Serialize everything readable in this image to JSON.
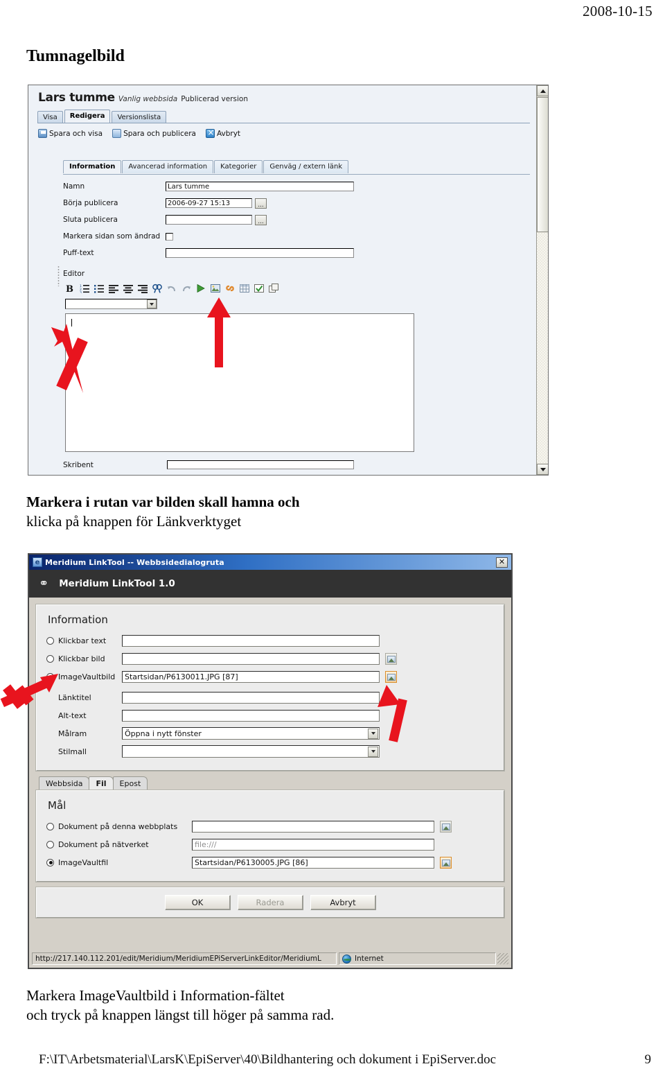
{
  "document": {
    "date": "2008-10-15",
    "title": "Tumnagelbild",
    "footer_path": "F:\\IT\\Arbetsmaterial\\LarsK\\EpiServer\\40\\Bildhantering och dokument i EpiServer.doc",
    "footer_page": "9"
  },
  "caption1": {
    "line1": "Markera i rutan var bilden skall hamna och",
    "line2": "klicka på knappen för Länkverktyget"
  },
  "caption2": {
    "line1": "Markera ImageVaultbild i Information-fältet",
    "line2": "och tryck på knappen längst till höger på samma rad."
  },
  "episerver": {
    "page_name": "Lars tumme",
    "page_type": "Vanlig webbsida",
    "page_status": "Publicerad version",
    "tabs": [
      {
        "label": "Visa",
        "active": false
      },
      {
        "label": "Redigera",
        "active": true
      },
      {
        "label": "Versionslista",
        "active": false
      }
    ],
    "commands": [
      {
        "label": "Spara och visa",
        "icon": "save-view-icon"
      },
      {
        "label": "Spara och publicera",
        "icon": "save-publish-icon"
      },
      {
        "label": "Avbryt",
        "icon": "cancel-icon"
      }
    ],
    "subtabs": [
      {
        "label": "Information",
        "active": true
      },
      {
        "label": "Avancerad information",
        "active": false
      },
      {
        "label": "Kategorier",
        "active": false
      },
      {
        "label": "Genväg / extern länk",
        "active": false
      }
    ],
    "fields": {
      "namn_label": "Namn",
      "namn_value": "Lars tumme",
      "borja_label": "Börja publicera",
      "borja_value": "2006-09-27 15:13",
      "sluta_label": "Sluta publicera",
      "sluta_value": "",
      "markera_label": "Markera sidan som ändrad",
      "puff_label": "Puff-text",
      "puff_value": "",
      "editor_label": "Editor",
      "skribent_label": "Skribent",
      "skribent_value": "",
      "browse_button": "...",
      "format_select_value": ""
    },
    "toolbar_icons": [
      "bold-icon",
      "ordered-list-icon",
      "unordered-list-icon",
      "align-left-icon",
      "align-center-icon",
      "align-right-icon",
      "find-icon",
      "undo-icon",
      "redo-icon",
      "spellcheck-icon",
      "insert-image-icon",
      "insert-link-icon",
      "insert-table-icon",
      "form-field-icon",
      "window-icon"
    ]
  },
  "linktool": {
    "window_title": "Meridium LinkTool -- Webbsidedialogruta",
    "close_label": "✕",
    "banner_icon": "link-chain-icon",
    "banner_title": "Meridium LinkTool 1.0",
    "information": {
      "heading": "Information",
      "rows": [
        {
          "label": "Klickbar text",
          "value": "",
          "radio": false,
          "has_radio": true,
          "has_button": false
        },
        {
          "label": "Klickbar bild",
          "value": "",
          "radio": false,
          "has_radio": true,
          "has_button": true
        },
        {
          "label": "ImageVaultbild",
          "value": "Startsidan/P6130011.JPG [87]",
          "radio": true,
          "has_radio": true,
          "has_button": true
        },
        {
          "label": "Länktitel",
          "value": "",
          "radio": false,
          "has_radio": false,
          "has_button": false
        },
        {
          "label": "Alt-text",
          "value": "",
          "radio": false,
          "has_radio": false,
          "has_button": false
        }
      ],
      "malram_label": "Målram",
      "malram_value": "Öppna i nytt fönster",
      "stilmall_label": "Stilmall",
      "stilmall_value": ""
    },
    "tabs": [
      {
        "label": "Webbsida",
        "active": false
      },
      {
        "label": "Fil",
        "active": true
      },
      {
        "label": "Epost",
        "active": false
      }
    ],
    "mal": {
      "heading": "Mål",
      "rows": [
        {
          "label": "Dokument på denna webbplats",
          "value": "",
          "radio": false,
          "has_button": true
        },
        {
          "label": "Dokument på nätverket",
          "value": "file:///",
          "radio": false,
          "has_button": false,
          "placeholder": true
        },
        {
          "label": "ImageVaultfil",
          "value": "Startsidan/P6130005.JPG [86]",
          "radio": true,
          "has_button": true
        }
      ]
    },
    "buttons": [
      {
        "label": "OK",
        "disabled": false
      },
      {
        "label": "Radera",
        "disabled": true
      },
      {
        "label": "Avbryt",
        "disabled": false
      }
    ],
    "statusbar": {
      "url": "http://217.140.112.201/edit/Meridium/MeridiumEPiServerLinkEditor/MeridiumL",
      "zone": "Internet",
      "zone_icon": "globe-icon"
    }
  },
  "annotations": {
    "arrow_color": "#e8141e",
    "arrows": [
      {
        "name": "arrow-to-editor-area",
        "desc": "points up-left into the editor text box"
      },
      {
        "name": "arrow-to-link-button",
        "desc": "points up at the link toolbar button"
      },
      {
        "name": "arrow-to-imagevault-radio",
        "desc": "points up-right at the ImageVaultbild radio"
      },
      {
        "name": "arrow-to-imagevault-browse",
        "desc": "points up at the ImageVaultbild browse button"
      }
    ]
  }
}
